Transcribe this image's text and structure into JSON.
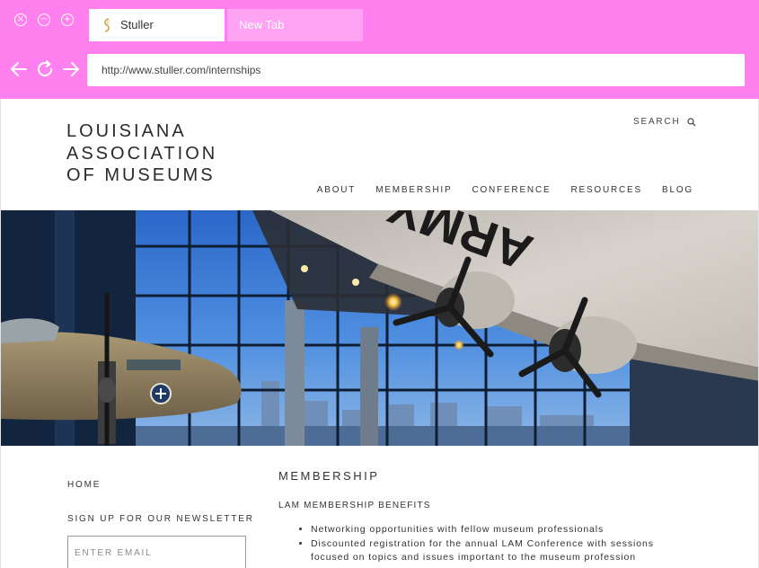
{
  "browser": {
    "tabs": [
      {
        "label": "Stuller",
        "active": true
      },
      {
        "label": "New Tab",
        "active": false
      }
    ],
    "url": "http://www.stuller.com/internships",
    "window_controls": [
      "close-icon",
      "minimize-icon",
      "maximize-icon"
    ],
    "chrome_color": "#ff80ee"
  },
  "site": {
    "logo_lines": [
      "LOUISIANA",
      "ASSOCIATION",
      "OF MUSEUMS"
    ],
    "search_label": "SEARCH",
    "nav": [
      "ABOUT",
      "MEMBERSHIP",
      "CONFERENCE",
      "RESOURCES",
      "BLOG"
    ]
  },
  "sidebar": {
    "home_label": "HOME",
    "newsletter_heading": "SIGN UP FOR OUR NEWSLETTER",
    "email_placeholder": "ENTER EMAIL"
  },
  "content": {
    "title": "MEMBERSHIP",
    "subtitle": "LAM MEMBERSHIP BENEFITS",
    "benefits": [
      "Networking opportunities with fellow museum professionals",
      "Discounted registration for the annual LAM Conference with sessions focused on topics and issues important to the museum profession"
    ]
  },
  "hero": {
    "wing_text": "ARMY"
  }
}
